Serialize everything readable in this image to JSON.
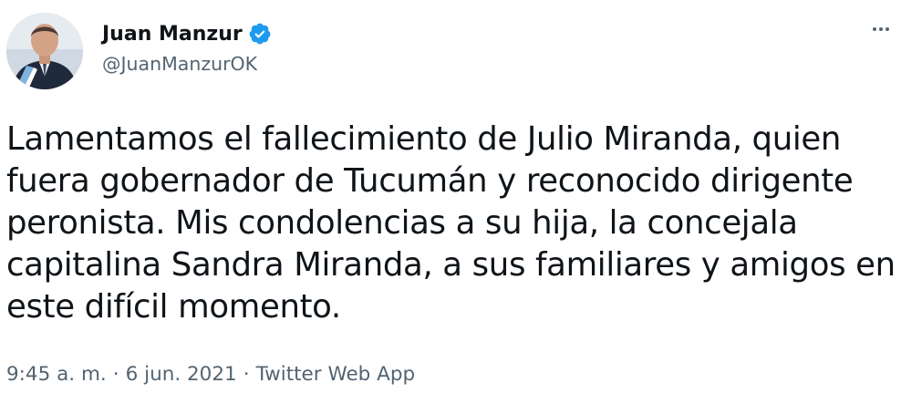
{
  "author": {
    "display_name": "Juan Manzur",
    "username": "@JuanManzurOK",
    "verified": true,
    "avatar_icon": "profile-photo",
    "verified_icon": "verified-badge-icon",
    "verified_color": "#1d9bf0"
  },
  "tweet": {
    "text_lines": [
      "Lamentamos el fallecimiento de Julio Miranda, quien",
      "fuera gobernador de Tucumán y reconocido dirigente",
      "peronista. Mis condolencias a su hija, la concejala",
      "capitalina Sandra Miranda, a sus familiares y amigos en",
      "este difícil momento."
    ]
  },
  "meta": {
    "time": "9:45 a. m.",
    "separator": "·",
    "date": "6 jun. 2021",
    "source": "Twitter Web App"
  },
  "menu": {
    "more_icon": "more-options-icon"
  },
  "colors": {
    "text_primary": "#0f1419",
    "text_secondary": "#536471",
    "background": "#ffffff"
  }
}
